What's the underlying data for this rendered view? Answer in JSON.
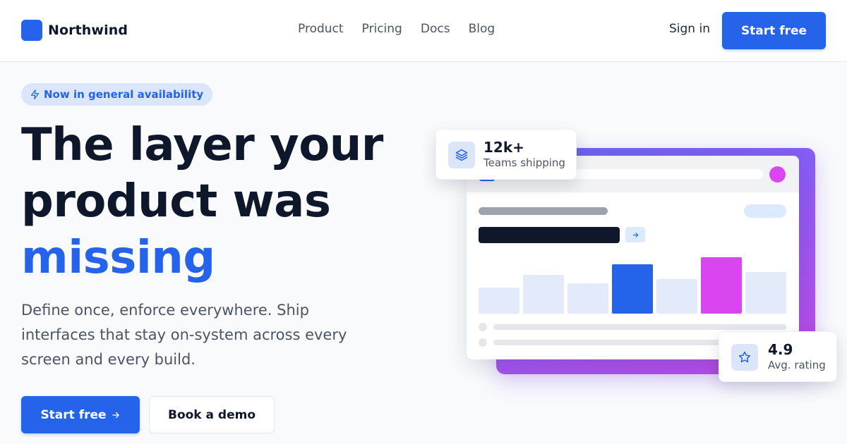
{
  "header": {
    "brand": "Northwind",
    "nav": [
      "Product",
      "Pricing",
      "Docs",
      "Blog"
    ],
    "sign_in": "Sign in",
    "cta": "Start free"
  },
  "hero": {
    "badge": "Now in general availability",
    "headline_line1": "The layer your",
    "headline_line2": "product was",
    "headline_accent": "missing",
    "subtext": "Define once, enforce everywhere. Ship interfaces that stay on-system across every screen and every build.",
    "primary_cta": "Start free",
    "secondary_cta": "Book a demo"
  },
  "stats": {
    "teams": {
      "value": "12k+",
      "label": "Teams shipping"
    },
    "rating": {
      "value": "4.9",
      "label": "Avg. rating"
    }
  },
  "mock_chart": {
    "bars": [
      {
        "value": 0.43,
        "color": "#e3ebfb"
      },
      {
        "value": 0.65,
        "color": "#e3ebfb"
      },
      {
        "value": 0.5,
        "color": "#e3ebfb"
      },
      {
        "value": 0.82,
        "color": "#2563eb"
      },
      {
        "value": 0.58,
        "color": "#e3ebfb"
      },
      {
        "value": 0.94,
        "color": "#d946ef"
      },
      {
        "value": 0.69,
        "color": "#e3ebfb"
      }
    ]
  },
  "colors": {
    "accent": "#2563eb",
    "magenta": "#d946ef",
    "gradient_start": "#6366f1",
    "gradient_end": "#c04ae6"
  },
  "icons": [
    "logo-mark",
    "bolt-icon",
    "arrow-right-icon",
    "layers-icon",
    "star-icon"
  ]
}
